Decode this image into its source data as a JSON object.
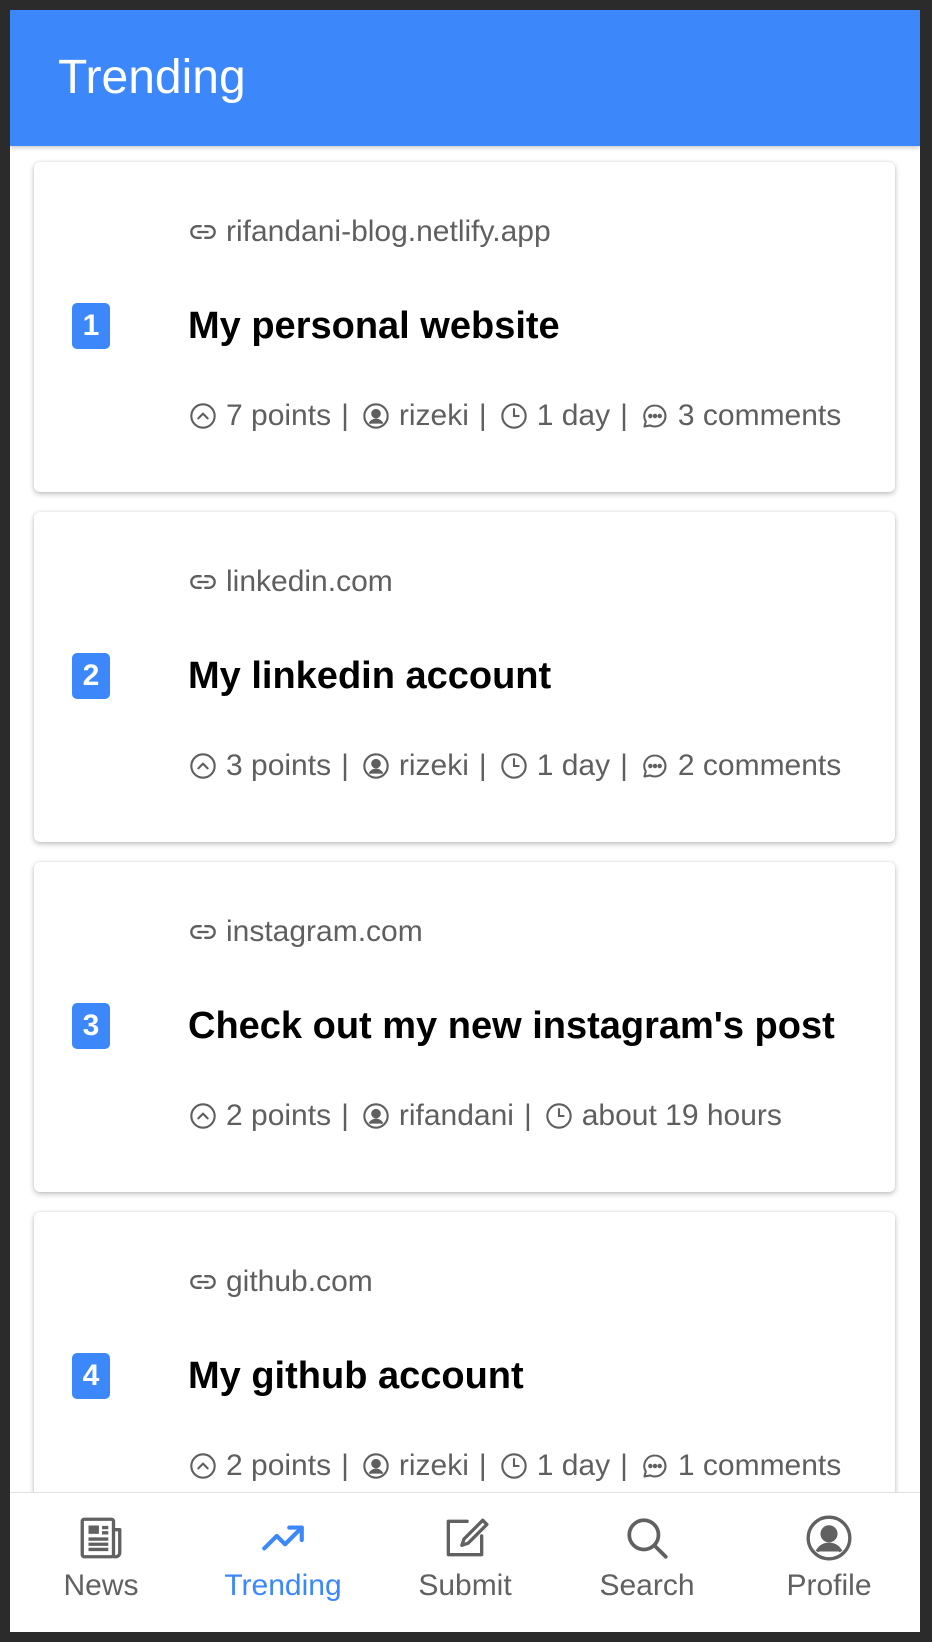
{
  "appbar": {
    "title": "Trending"
  },
  "colors": {
    "accent": "#3c87fa",
    "text_muted": "#5f5f5f"
  },
  "posts": [
    {
      "rank": "1",
      "domain": "rifandani-blog.netlify.app",
      "title": "My personal website",
      "points": "7 points",
      "author": "rizeki",
      "time": "1 day",
      "comments": "3 comments"
    },
    {
      "rank": "2",
      "domain": "linkedin.com",
      "title": "My linkedin account",
      "points": "3 points",
      "author": "rizeki",
      "time": "1 day",
      "comments": "2 comments"
    },
    {
      "rank": "3",
      "domain": "instagram.com",
      "title": "Check out my new instagram's post",
      "points": "2 points",
      "author": "rifandani",
      "time": "about 19 hours",
      "comments": null
    },
    {
      "rank": "4",
      "domain": "github.com",
      "title": "My github account",
      "points": "2 points",
      "author": "rizeki",
      "time": "1 day",
      "comments": "1 comments"
    }
  ],
  "separator": "|",
  "nav": {
    "active": "trending",
    "items": [
      {
        "id": "news",
        "label": "News",
        "icon": "newspaper-icon"
      },
      {
        "id": "trending",
        "label": "Trending",
        "icon": "trending-up-icon"
      },
      {
        "id": "submit",
        "label": "Submit",
        "icon": "edit-square-icon"
      },
      {
        "id": "search",
        "label": "Search",
        "icon": "search-icon"
      },
      {
        "id": "profile",
        "label": "Profile",
        "icon": "user-circle-icon"
      }
    ]
  }
}
